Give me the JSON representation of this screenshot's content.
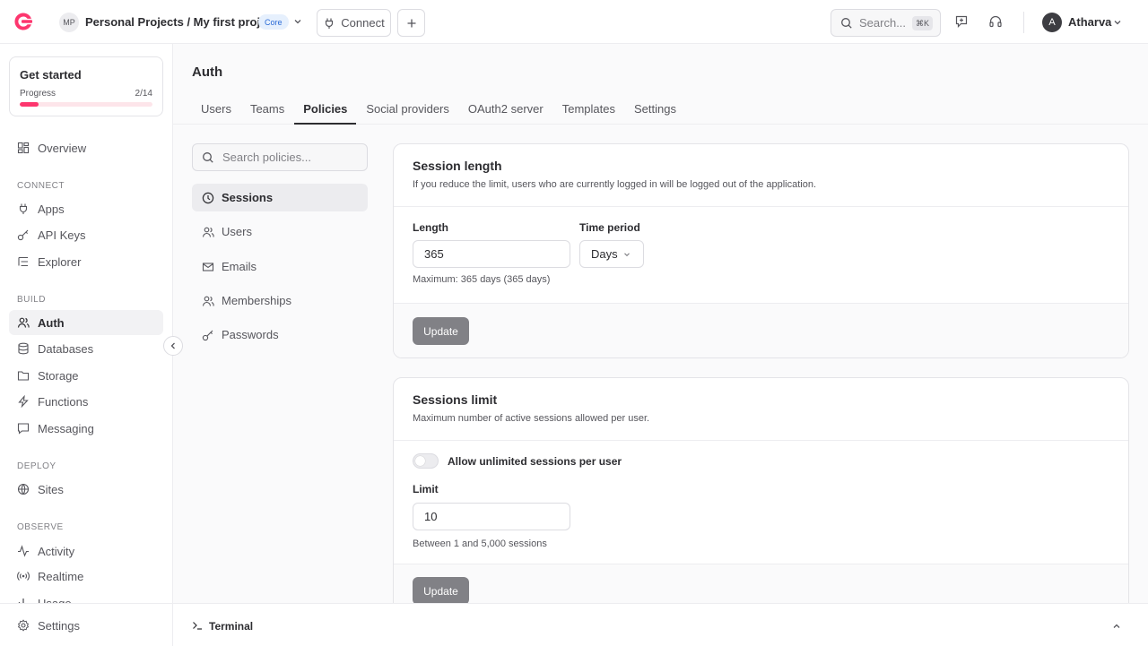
{
  "header": {
    "project_initials": "MP",
    "breadcrumb": "Personal Projects / My first project",
    "plan_badge": "Core",
    "connect_label": "Connect",
    "search_placeholder": "Search...",
    "search_shortcut": "⌘K",
    "user_initial": "A",
    "user_name": "Atharva"
  },
  "sidebar": {
    "get_started": {
      "title": "Get started",
      "progress_label": "Progress",
      "progress_text": "2/14",
      "progress": 0.143
    },
    "overview": "Overview",
    "sections": {
      "connect": "CONNECT",
      "build": "BUILD",
      "deploy": "DEPLOY",
      "observe": "OBSERVE"
    },
    "connect_items": [
      "Apps",
      "API Keys",
      "Explorer"
    ],
    "build_items": [
      "Auth",
      "Databases",
      "Storage",
      "Functions",
      "Messaging"
    ],
    "deploy_items": [
      "Sites"
    ],
    "observe_items": [
      "Activity",
      "Realtime",
      "Usage"
    ],
    "settings": "Settings"
  },
  "main": {
    "title": "Auth",
    "tabs": [
      "Users",
      "Teams",
      "Policies",
      "Social providers",
      "OAuth2 server",
      "Templates",
      "Settings"
    ],
    "policy_search_placeholder": "Search policies...",
    "policies_nav": [
      "Sessions",
      "Users",
      "Emails",
      "Memberships",
      "Passwords"
    ]
  },
  "session_length": {
    "title": "Session length",
    "description": "If you reduce the limit, users who are currently logged in will be logged out of the application.",
    "length_label": "Length",
    "length_value": "365",
    "period_label": "Time period",
    "period_value": "Days",
    "help": "Maximum: 365 days (365 days)",
    "update_label": "Update"
  },
  "sessions_limit": {
    "title": "Sessions limit",
    "description": "Maximum number of active sessions allowed per user.",
    "toggle_label": "Allow unlimited sessions per user",
    "limit_label": "Limit",
    "limit_value": "10",
    "help": "Between 1 and 5,000 sessions",
    "update_label": "Update"
  },
  "terminal": {
    "label": "Terminal"
  }
}
